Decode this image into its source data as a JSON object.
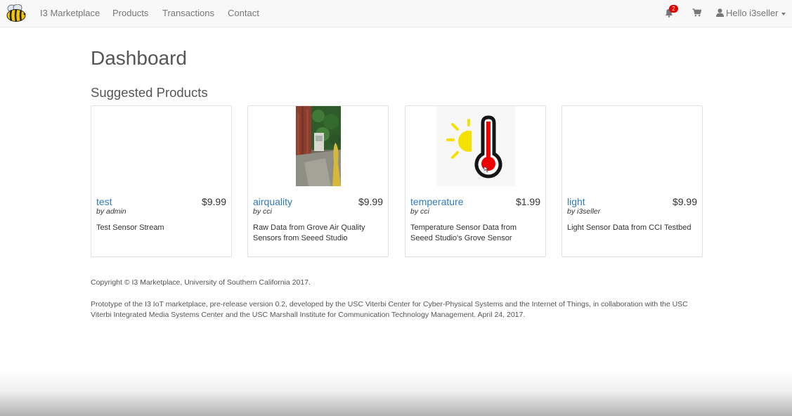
{
  "nav": {
    "brand": "I3 Marketplace",
    "links": [
      "Products",
      "Transactions",
      "Contact"
    ],
    "notification_count": "2",
    "user_greeting": "Hello i3seller"
  },
  "main": {
    "title": "Dashboard",
    "section_title": "Suggested Products",
    "products": [
      {
        "name": "test",
        "price": "$9.99",
        "seller": "by admin",
        "description": "Test Sensor Stream",
        "image": "none"
      },
      {
        "name": "airquality",
        "price": "$9.99",
        "seller": "by cci",
        "description": "Raw Data from Grove Air Quality Sensors from Seeed Studio",
        "image": "alley-photo"
      },
      {
        "name": "temperature",
        "price": "$1.99",
        "seller": "by cci",
        "description": "Temperature Sensor Data from Seeed Studio's Grove Sensor",
        "image": "thermometer-sun-icon"
      },
      {
        "name": "light",
        "price": "$9.99",
        "seller": "by i3seller",
        "description": "Light Sensor Data from CCI Testbed",
        "image": "none"
      }
    ]
  },
  "footer": {
    "copyright": "Copyright © I3 Marketplace, University of Southern California 2017.",
    "note": "Prototype of the I3 IoT marketplace, pre-release version 0.2, developed by the USC Viterbi Center for Cyber-Physical Systems and the Internet of Things, in collaboration with the USC Viterbi Integrated Media Systems Center and the USC Marshall Institute for Communication Technology Management. April 24, 2017."
  },
  "colors": {
    "link": "#337ab7",
    "navbar_bg": "#f8f8f8",
    "badge": "#e00000",
    "thermometer_red": "#ee0000",
    "sun_yellow": "#f5e100"
  }
}
